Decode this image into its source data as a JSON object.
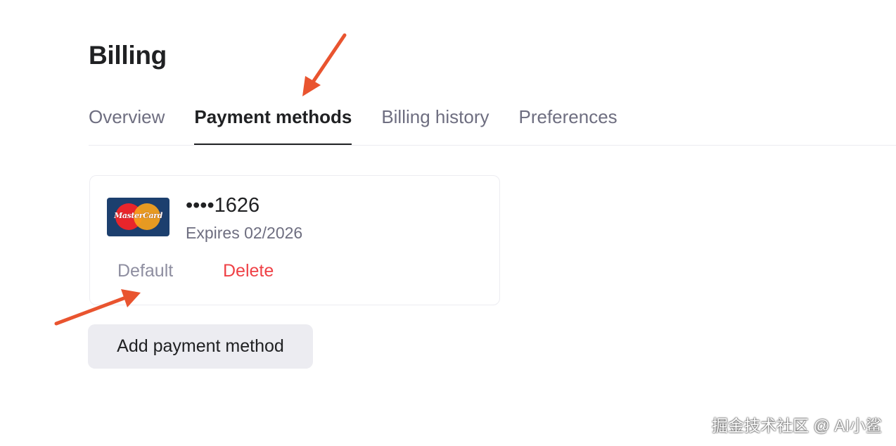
{
  "page": {
    "title": "Billing"
  },
  "tabs": [
    {
      "label": "Overview",
      "active": false
    },
    {
      "label": "Payment methods",
      "active": true
    },
    {
      "label": "Billing history",
      "active": false
    },
    {
      "label": "Preferences",
      "active": false
    }
  ],
  "payment_method": {
    "brand": "Mastercard",
    "brand_logo_text": "MasterCard",
    "brand_icon": "mastercard-logo",
    "number": "••••1626",
    "expiry": "Expires 02/2026",
    "default_label": "Default",
    "delete_label": "Delete"
  },
  "add_button": {
    "label": "Add payment method"
  },
  "annotations": {
    "arrow_color": "#e9542f"
  },
  "watermark": {
    "text": "掘金技术社区 @ AI小鲨"
  },
  "colors": {
    "text_primary": "#202123",
    "text_secondary": "#6e6e80",
    "danger": "#ef4146",
    "button_bg": "#ececf1"
  }
}
